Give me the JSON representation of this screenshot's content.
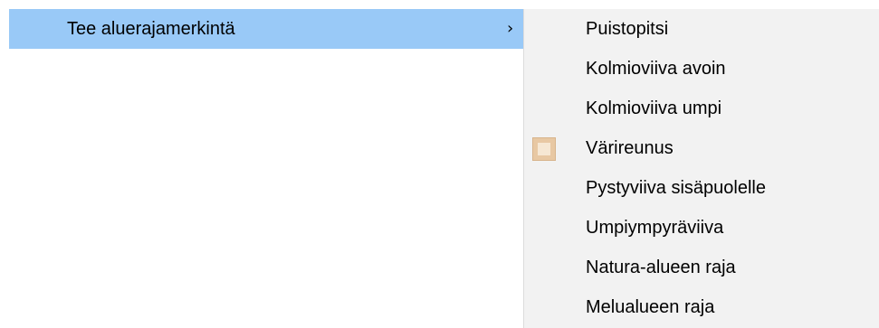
{
  "menu": {
    "parent_item": {
      "label": "Tee aluerajamerkintä",
      "chevron": "›",
      "highlight_color": "#99c9f7"
    },
    "submenu": {
      "items": [
        {
          "label": "Puistopitsi",
          "checked": false
        },
        {
          "label": "Kolmioviiva avoin",
          "checked": false
        },
        {
          "label": "Kolmioviiva umpi",
          "checked": false
        },
        {
          "label": "Värireunus",
          "checked": true,
          "icon": "checked-item-icon"
        },
        {
          "label": "Pystyviiva sisäpuolelle",
          "checked": false
        },
        {
          "label": "Umpiympyräviiva",
          "checked": false
        },
        {
          "label": "Natura-alueen raja",
          "checked": false
        },
        {
          "label": "Melualueen raja",
          "checked": false
        }
      ]
    }
  }
}
